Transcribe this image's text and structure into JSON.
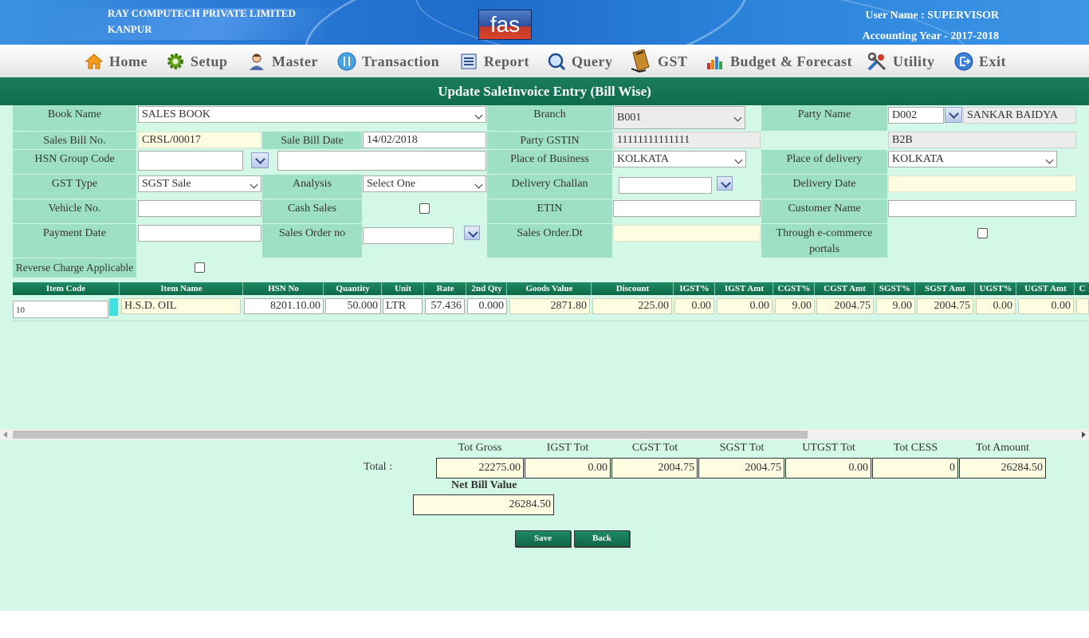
{
  "header": {
    "company_name": "RAY COMPUTECH PRIVATE LIMITED",
    "company_city": "KANPUR",
    "logo_text": "fas",
    "user_name": "User Name : SUPERVISOR",
    "accounting_year": "Accounting Year - 2017-2018"
  },
  "menu": {
    "items": [
      {
        "label": "Home",
        "icon": "home-icon"
      },
      {
        "label": "Setup",
        "icon": "gear-icon"
      },
      {
        "label": "Master",
        "icon": "user-icon"
      },
      {
        "label": "Transaction",
        "icon": "transaction-icon"
      },
      {
        "label": "Report",
        "icon": "report-icon"
      },
      {
        "label": "Query",
        "icon": "query-icon"
      },
      {
        "label": "GST",
        "icon": "gst-book-icon"
      },
      {
        "label": "Budget & Forecast",
        "icon": "bar-chart-icon"
      },
      {
        "label": "Utility",
        "icon": "tools-icon"
      },
      {
        "label": "Exit",
        "icon": "exit-icon"
      }
    ]
  },
  "page_title": "Update SaleInvoice Entry (Bill Wise)",
  "form": {
    "book_name_label": "Book Name",
    "book_name_value": "SALES BOOK",
    "branch_label": "Branch",
    "branch_value": "B001",
    "party_name_label": "Party Name",
    "party_code_value": "D002",
    "party_name_value": "SANKAR BAIDYA",
    "sales_bill_no_label": "Sales Bill No.",
    "sales_bill_no_value": "CRSL/00017",
    "sale_bill_date_label": "Sale Bill Date",
    "sale_bill_date_value": "14/02/2018",
    "party_gstin_label": "Party GSTIN",
    "party_gstin_value": "11111111111111",
    "party_type_value": "B2B",
    "hsn_group_code_label": "HSN Group Code",
    "hsn_group_code_value": "",
    "hsn_group_name_value": "",
    "place_of_business_label": "Place of Business",
    "place_of_business_value": "KOLKATA",
    "place_of_delivery_label": "Place of delivery",
    "place_of_delivery_value": "KOLKATA",
    "gst_type_label": "GST Type",
    "gst_type_value": "SGST Sale",
    "analysis_label": "Analysis",
    "analysis_value": "Select One",
    "delivery_challan_label": "Delivery Challan",
    "delivery_challan_value": "",
    "delivery_date_label": "Delivery Date",
    "delivery_date_value": "",
    "vehicle_no_label": "Vehicle No.",
    "vehicle_no_value": "",
    "cash_sales_label": "Cash Sales",
    "etin_label": "ETIN",
    "etin_value": "",
    "customer_name_label": "Customer Name",
    "customer_name_value": "",
    "payment_date_label": "Payment Date",
    "payment_date_value": "",
    "sales_order_no_label": "Sales Order no",
    "sales_order_no_value": "",
    "sales_order_dt_label": "Sales Order.Dt",
    "sales_order_dt_value": "",
    "ecommerce_label_line1": "Through e-commerce",
    "ecommerce_label_line2": "portals",
    "reverse_charge_label": "Reverse Charge Applicable"
  },
  "grid": {
    "headers": [
      "Item Code",
      "Item Name",
      "HSN No",
      "Quantity",
      "Unit",
      "Rate",
      "2nd Qty",
      "Goods Value",
      "Discount",
      "IGST%",
      "IGST Amt",
      "CGST%",
      "CGST Amt",
      "SGST%",
      "SGST Amt",
      "UGST%",
      "UGST Amt",
      "C"
    ],
    "row": {
      "item_code": "10",
      "item_name": "H.S.D. OIL",
      "hsn_no": "8201.10.00",
      "quantity": "50.000",
      "unit": "LTR",
      "rate": "57.436",
      "second_qty": "0.000",
      "goods_value": "2871.80",
      "discount": "225.00",
      "igst_pct": "0.00",
      "igst_amt": "0.00",
      "cgst_pct": "9.00",
      "cgst_amt": "2004.75",
      "sgst_pct": "9.00",
      "sgst_amt": "2004.75",
      "ugst_pct": "0.00",
      "ugst_amt": "0.00"
    }
  },
  "totals": {
    "label": "Total :",
    "headers": [
      "Tot Gross",
      "IGST Tot",
      "CGST Tot",
      "SGST Tot",
      "UTGST Tot",
      "Tot CESS",
      "Tot Amount"
    ],
    "values": [
      "22275.00",
      "0.00",
      "2004.75",
      "2004.75",
      "0.00",
      "0",
      "26284.50"
    ],
    "net_bill_label": "Net Bill Value",
    "net_bill_value": "26284.50"
  },
  "buttons": {
    "save_label": "Save",
    "back_label": "Back"
  }
}
